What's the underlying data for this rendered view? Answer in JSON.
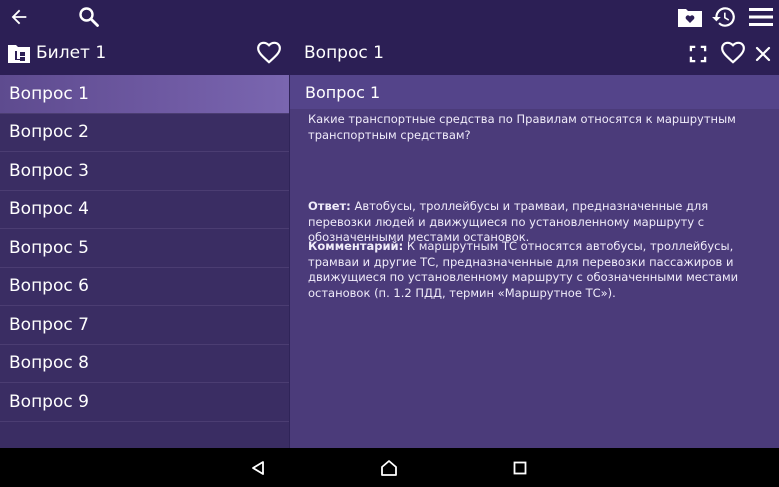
{
  "ticket": {
    "title": "Билет 1"
  },
  "detail": {
    "header_title": "Вопрос 1",
    "question_title": "Вопрос 1"
  },
  "questions": [
    "Вопрос 1",
    "Вопрос 2",
    "Вопрос 3",
    "Вопрос 4",
    "Вопрос 5",
    "Вопрос 6",
    "Вопрос 7",
    "Вопрос 8",
    "Вопрос 9"
  ],
  "question": {
    "text": "Какие транспортные средства по Правилам относятся к маршрутным транспортным средствам?",
    "answer_label": "Ответ:",
    "answer_text": " Автобусы, троллейбусы и трамваи, предназначенные для перевозки людей и движущиеся по установленному маршруту с обозначенными местами остановок.",
    "comment_label": "Комментарий:",
    "comment_text": " К маршрутным ТС относятся автобусы, троллейбусы, трамваи и другие ТС, предназначенные для перевозки пассажиров и движущиеся по установленному маршруту с обозначенными местами остановок (п. 1.2 ПДД, термин «Маршрутное ТС»)."
  },
  "icons": {
    "back": "arrow-left-icon",
    "search": "search-icon",
    "folder_heart": "folder-heart-icon",
    "history": "history-icon",
    "menu": "menu-icon",
    "ticket": "file-tree-icon",
    "favorite": "heart-icon",
    "fullscreen": "fullscreen-icon",
    "close": "close-icon"
  },
  "colors": {
    "bar": "#2c1f55",
    "list_bg": "#3a2d63",
    "content_bg": "#4b3b7a",
    "active": "#6f5aa3"
  }
}
